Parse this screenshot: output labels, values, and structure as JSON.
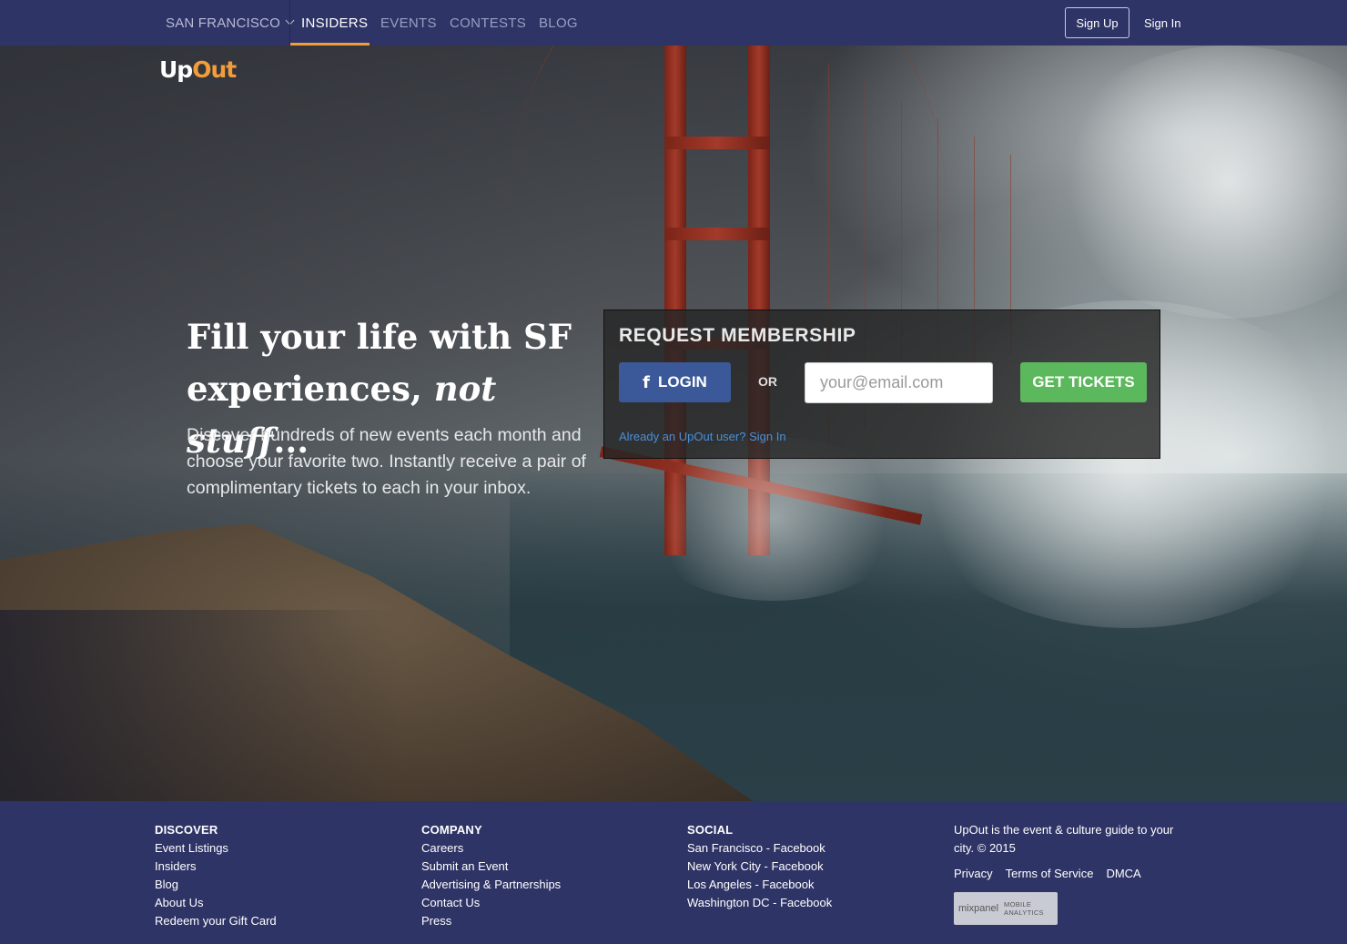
{
  "nav": {
    "city": "SAN FRANCISCO",
    "links": [
      "INSIDERS",
      "EVENTS",
      "CONTESTS",
      "BLOG"
    ],
    "signup": "Sign Up",
    "signin": "Sign In"
  },
  "logo": {
    "part1": "Up",
    "part2": "Out"
  },
  "hero": {
    "headline_1": "Fill your life with SF",
    "headline_2": "experiences,",
    "headline_em": "not stuff",
    "headline_end": "...",
    "subtext": "Discover hundreds of new events each month and choose your favorite two. Instantly receive a pair of complimentary tickets to each in your inbox."
  },
  "membership": {
    "title": "REQUEST MEMBERSHIP",
    "facebook_login": "LOGIN",
    "or": "OR",
    "email_placeholder": "your@email.com",
    "get_tickets": "GET TICKETS",
    "already_user": "Already an UpOut user? Sign In"
  },
  "footer": {
    "discover": {
      "heading": "DISCOVER",
      "links": [
        "Event Listings",
        "Insiders",
        "Blog",
        "About Us",
        "Redeem your Gift Card"
      ]
    },
    "company": {
      "heading": "COMPANY",
      "links": [
        "Careers",
        "Submit an Event",
        "Advertising & Partnerships",
        "Contact Us",
        "Press"
      ]
    },
    "social": {
      "heading": "SOCIAL",
      "links": [
        "San Francisco - Facebook",
        "New York City - Facebook",
        "Los Angeles - Facebook",
        "Washington DC - Facebook"
      ]
    },
    "about": "UpOut is the event & culture guide to your city. © 2015",
    "legal": [
      "Privacy",
      "Terms of Service",
      "DMCA"
    ],
    "badge": {
      "brand": "mixpanel",
      "line1": "MOBILE",
      "line2": "ANALYTICS"
    }
  },
  "colors": {
    "nav_bg": "#2f3466",
    "accent": "#f39c3a",
    "facebook": "#3b5998",
    "cta_green": "#5cb85c",
    "link_blue": "#4a90d9"
  }
}
